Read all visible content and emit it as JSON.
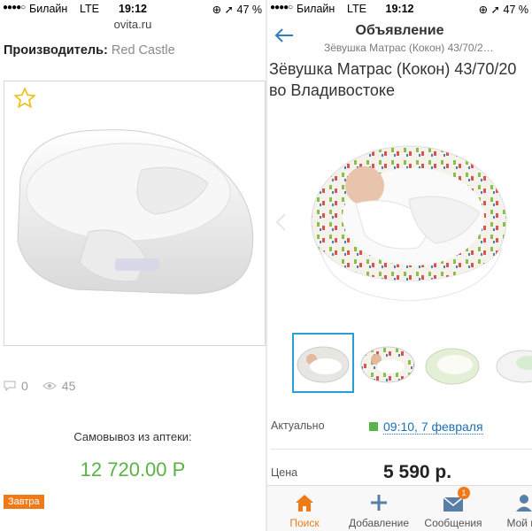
{
  "left": {
    "status": {
      "carrier": "Билайн",
      "network": "LTE",
      "time": "19:12",
      "battery": "47 %"
    },
    "url": "ovita.ru",
    "manufacturer_label": "Производитель:",
    "manufacturer_value": "Red Castle",
    "comments_count": "0",
    "views_count": "45",
    "pickup_text": "Самовывоз из аптеки:",
    "price": "12 720.00 Р",
    "badge": "Завтра"
  },
  "right": {
    "status": {
      "carrier": "Билайн",
      "network": "LTE",
      "time": "19:12",
      "battery": "47 %"
    },
    "nav_title": "Объявление",
    "nav_subtitle": "Зёвушка Матрас (Кокон) 43/70/2…",
    "ad_title_line1": "Зёвушка Матрас (Кокон) 43/70/20",
    "ad_title_line2": "во Владивостоке",
    "actual_label": "Актуально",
    "actual_date": "09:10, 7 февраля",
    "price_label": "Цена",
    "price": "5 590 р.",
    "tabs": [
      {
        "label": "Поиск",
        "icon": "home-icon",
        "active": true
      },
      {
        "label": "Добавление",
        "icon": "plus-icon",
        "active": false
      },
      {
        "label": "Сообщения",
        "icon": "envelope-icon",
        "active": false,
        "badge": "1"
      },
      {
        "label": "Мой ка",
        "icon": "user-icon",
        "active": false
      }
    ]
  },
  "colors": {
    "accent_orange": "#f07a18",
    "price_green": "#5bb146",
    "link_blue": "#1e6fb4",
    "selected_thumb": "#2a9fd6"
  }
}
